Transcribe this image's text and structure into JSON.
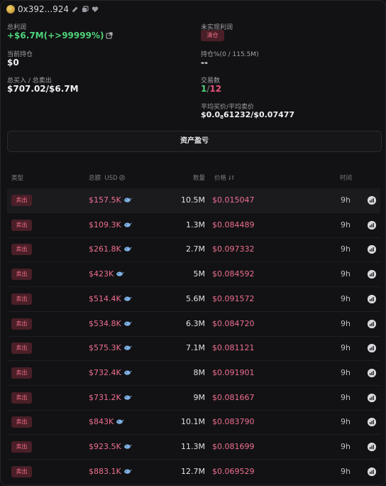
{
  "header": {
    "address": "0x392...924"
  },
  "summary": {
    "total_profit_label": "总利润",
    "total_profit_value": "+$6.7M(+>99999%)",
    "unrealized_label": "未实现利润",
    "clear_label": "清仓",
    "holding_label": "当前持仓",
    "holding_value": "$0",
    "holding_pct_label": "持仓%(0 / 115.5M)",
    "holding_pct_value": "--",
    "buy_sell_label": "总买入 / 总卖出",
    "buy_sell_value": "$707.02/$6.7M",
    "trades_label": "交易数",
    "trades_buys": "1",
    "trades_sep": "/",
    "trades_sells": "12",
    "avg_price_label": "平均买价/平均卖价",
    "avg_price_prefix": "$0.0",
    "avg_price_sub": "8",
    "avg_price_rest": "61232/$0.07477"
  },
  "asset_button_label": "资产盈亏",
  "table": {
    "col_type": "类型",
    "col_total": "总额",
    "col_total_unit": "USD",
    "col_amount": "数量",
    "col_price": "价格",
    "col_time": "时间",
    "rows": [
      {
        "type": "卖出",
        "total": "$157.5K",
        "amount": "10.5M",
        "price": "$0.015047",
        "time": "9h"
      },
      {
        "type": "卖出",
        "total": "$109.3K",
        "amount": "1.3M",
        "price": "$0.084489",
        "time": "9h"
      },
      {
        "type": "卖出",
        "total": "$261.8K",
        "amount": "2.7M",
        "price": "$0.097332",
        "time": "9h"
      },
      {
        "type": "卖出",
        "total": "$423K",
        "amount": "5M",
        "price": "$0.084592",
        "time": "9h"
      },
      {
        "type": "卖出",
        "total": "$514.4K",
        "amount": "5.6M",
        "price": "$0.091572",
        "time": "9h"
      },
      {
        "type": "卖出",
        "total": "$534.8K",
        "amount": "6.3M",
        "price": "$0.084720",
        "time": "9h"
      },
      {
        "type": "卖出",
        "total": "$575.3K",
        "amount": "7.1M",
        "price": "$0.081121",
        "time": "9h"
      },
      {
        "type": "卖出",
        "total": "$732.4K",
        "amount": "8M",
        "price": "$0.091901",
        "time": "9h"
      },
      {
        "type": "卖出",
        "total": "$731.2K",
        "amount": "9M",
        "price": "$0.081667",
        "time": "9h"
      },
      {
        "type": "卖出",
        "total": "$843K",
        "amount": "10.1M",
        "price": "$0.083790",
        "time": "9h"
      },
      {
        "type": "卖出",
        "total": "$923.5K",
        "amount": "11.3M",
        "price": "$0.081699",
        "time": "9h"
      },
      {
        "type": "卖出",
        "total": "$883.1K",
        "amount": "12.7M",
        "price": "$0.069529",
        "time": "9h"
      }
    ]
  },
  "colors": {
    "background": "#121214",
    "profit_green": "#4fd37a",
    "sell_pink": "#ef6e90",
    "badge_bg": "#4a1f28"
  },
  "icons": [
    "avatar-icon",
    "edit-icon",
    "copy-icon",
    "heart-icon",
    "external-link-icon",
    "swap-icon",
    "sort-icon",
    "whale-icon",
    "chart-icon"
  ]
}
